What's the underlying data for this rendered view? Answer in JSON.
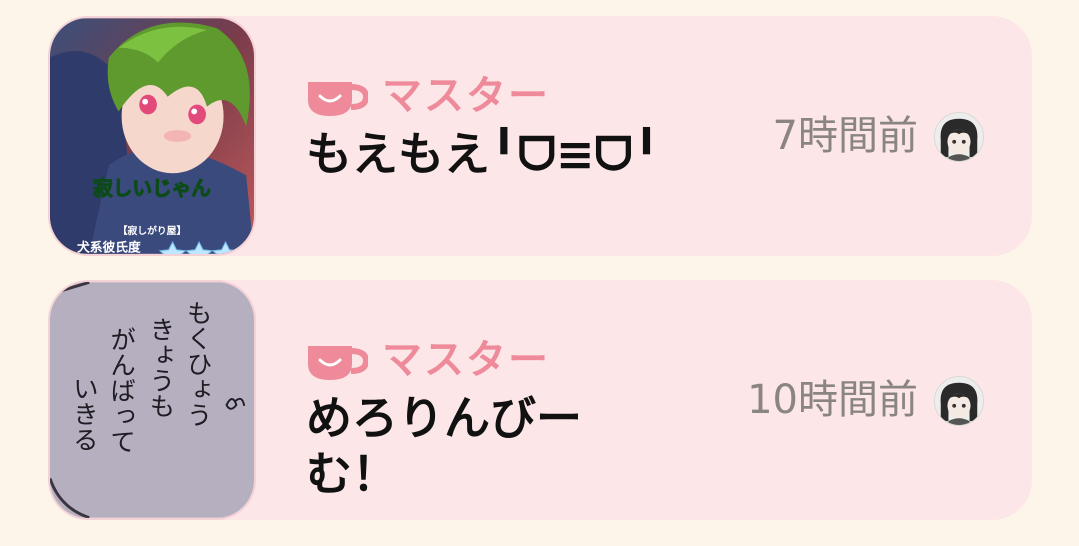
{
  "accent_color": "#ee8a99",
  "card_color": "#fde6e8",
  "background_color": "#fdf5e9",
  "notifications": [
    {
      "sender": "マスター",
      "message": "もえもえ╹ᗜ≡ᗜ╹",
      "time": "7時間前",
      "sender_icon": "coffee-cup-icon",
      "thumbnail": "anime-character-card-image",
      "thumbnail_caption": "寂しいじゃん",
      "thumbnail_subcaption": "【寂しがり屋】",
      "thumbnail_footer": "犬系彼氏度"
    },
    {
      "sender": "マスター",
      "message": "めろりんびー\nむ！",
      "time": "10時間前",
      "sender_icon": "coffee-cup-icon",
      "thumbnail": "handwritten-note-image",
      "thumbnail_note_lines": [
        "もくひょう",
        "きょうも",
        "がんばって",
        "いきる"
      ]
    }
  ]
}
